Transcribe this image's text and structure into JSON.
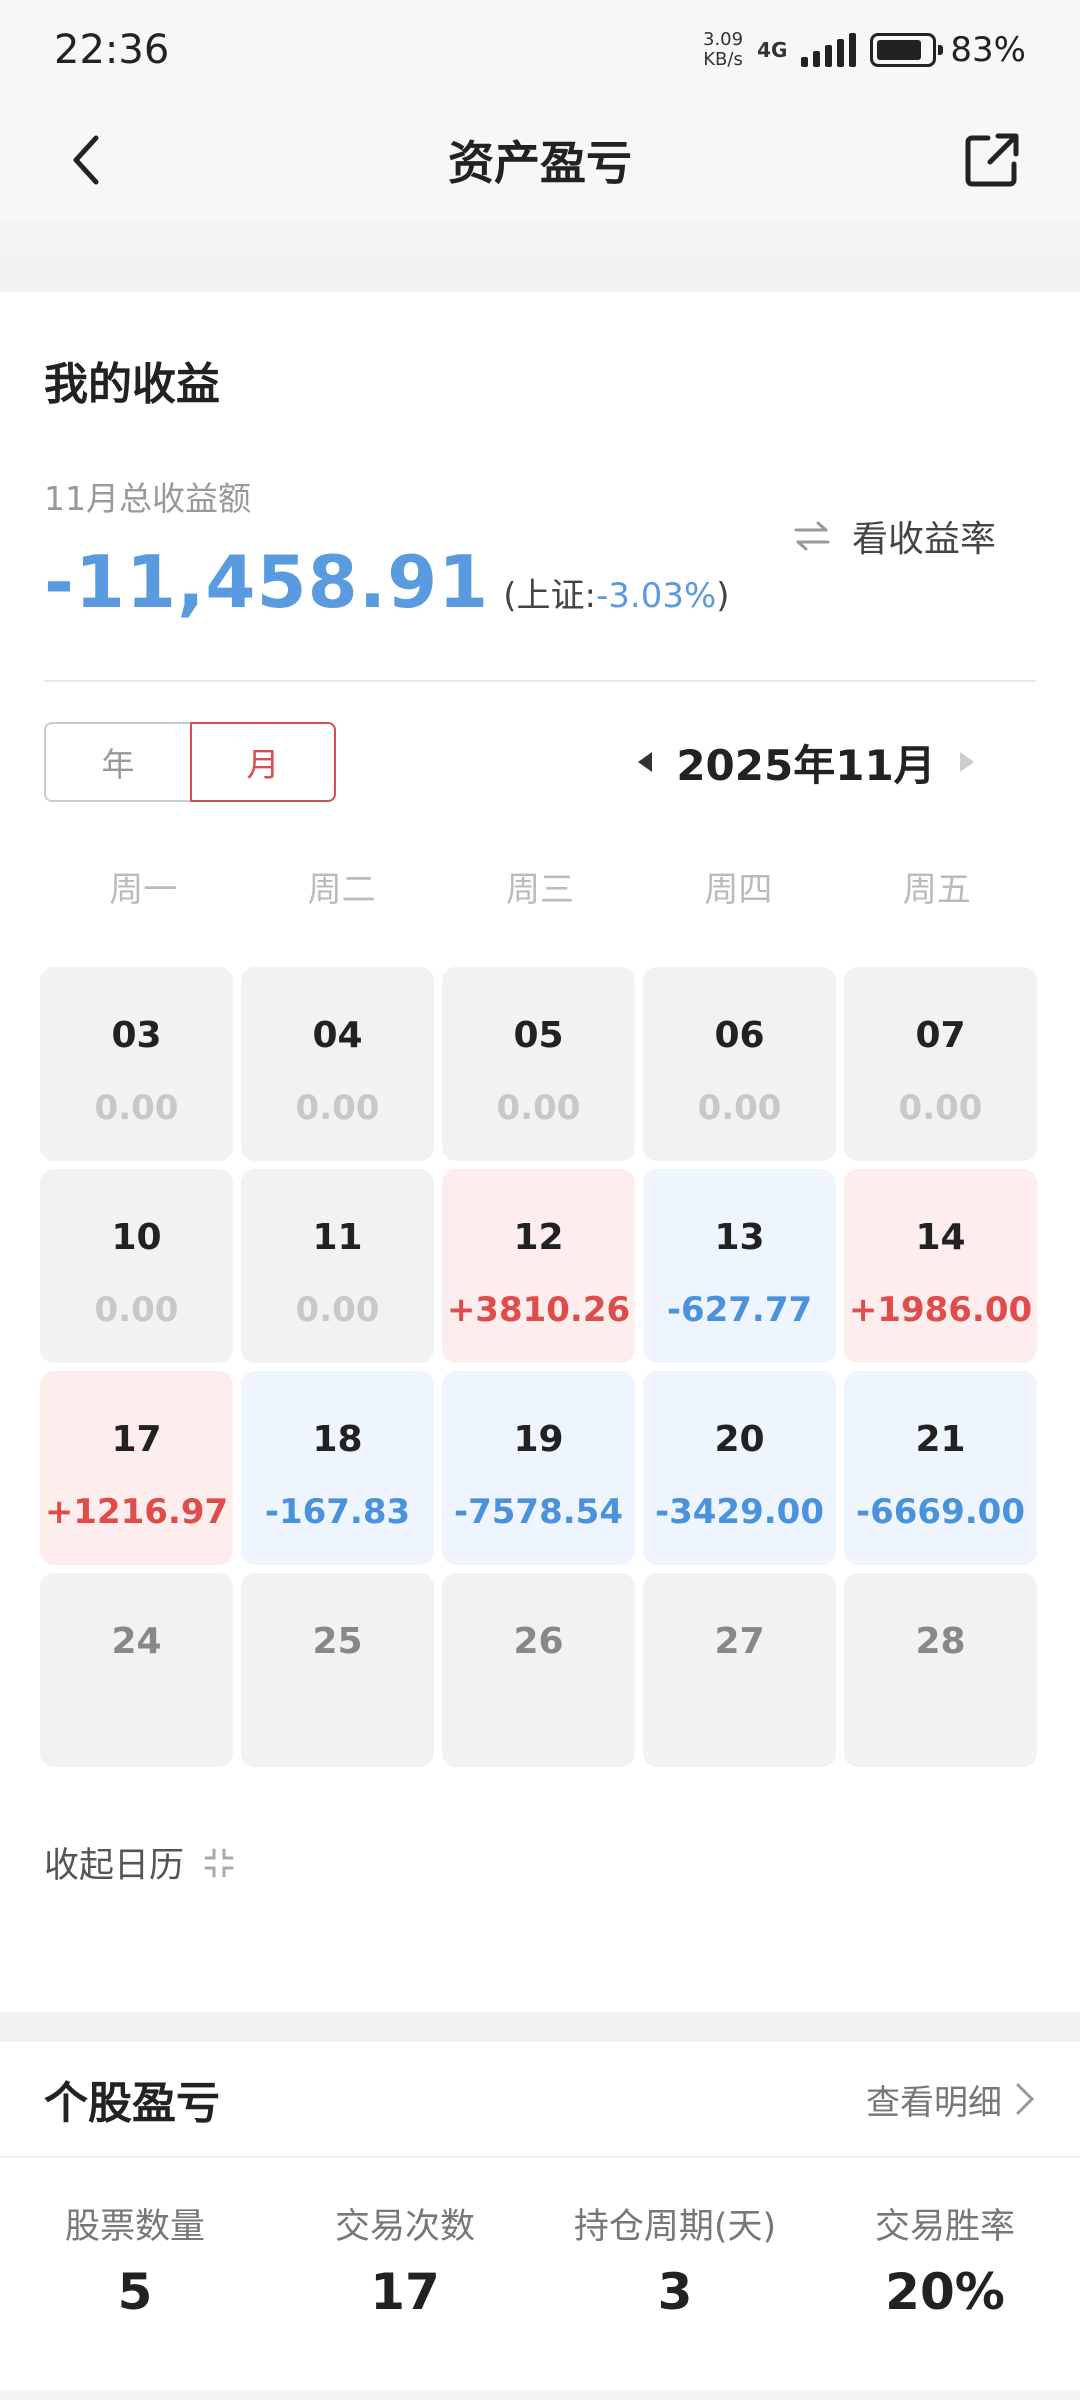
{
  "status_bar": {
    "time": "22:36",
    "net_speed_value": "3.09",
    "net_speed_unit": "KB/s",
    "net_type": "4G",
    "battery": "83%"
  },
  "nav": {
    "title": "资产盈亏"
  },
  "profit": {
    "title": "我的收益",
    "total_label": "11月总收益额",
    "toggle_label": "看收益率",
    "total_value": "-11,458.91",
    "index_prefix": "(上证:",
    "index_value": "-3.03%",
    "index_suffix": ")"
  },
  "period": {
    "year_label": "年",
    "month_label": "月",
    "current": "2025年11月"
  },
  "weekdays": [
    "周一",
    "周二",
    "周三",
    "周四",
    "周五"
  ],
  "calendar": [
    {
      "day": "03",
      "amount": "0.00",
      "state": "zero"
    },
    {
      "day": "04",
      "amount": "0.00",
      "state": "zero"
    },
    {
      "day": "05",
      "amount": "0.00",
      "state": "zero"
    },
    {
      "day": "06",
      "amount": "0.00",
      "state": "zero"
    },
    {
      "day": "07",
      "amount": "0.00",
      "state": "zero"
    },
    {
      "day": "10",
      "amount": "0.00",
      "state": "zero"
    },
    {
      "day": "11",
      "amount": "0.00",
      "state": "zero"
    },
    {
      "day": "12",
      "amount": "+3810.26",
      "state": "up"
    },
    {
      "day": "13",
      "amount": "-627.77",
      "state": "down"
    },
    {
      "day": "14",
      "amount": "+1986.00",
      "state": "up"
    },
    {
      "day": "17",
      "amount": "+1216.97",
      "state": "up"
    },
    {
      "day": "18",
      "amount": "-167.83",
      "state": "down"
    },
    {
      "day": "19",
      "amount": "-7578.54",
      "state": "down"
    },
    {
      "day": "20",
      "amount": "-3429.00",
      "state": "down"
    },
    {
      "day": "21",
      "amount": "-6669.00",
      "state": "down"
    },
    {
      "day": "24",
      "amount": "",
      "state": "future"
    },
    {
      "day": "25",
      "amount": "",
      "state": "future"
    },
    {
      "day": "26",
      "amount": "",
      "state": "future"
    },
    {
      "day": "27",
      "amount": "",
      "state": "future"
    },
    {
      "day": "28",
      "amount": "",
      "state": "future"
    }
  ],
  "collapse_label": "收起日历",
  "stocks": {
    "title": "个股盈亏",
    "link_label": "查看明细",
    "stats": [
      {
        "label": "股票数量",
        "value": "5"
      },
      {
        "label": "交易次数",
        "value": "17"
      },
      {
        "label": "持仓周期(天)",
        "value": "3"
      },
      {
        "label": "交易胜率",
        "value": "20%"
      }
    ]
  },
  "colors": {
    "gain": "#e04b4b",
    "loss": "#4a92dc",
    "accent": "#d84f4f"
  }
}
